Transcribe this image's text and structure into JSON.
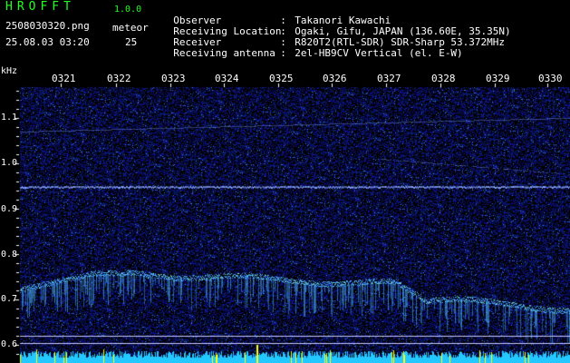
{
  "header": {
    "app_name": "HROFFT",
    "app_version": "1.0.0",
    "file_name": "2508030320.png",
    "date_time": "25.08.03 03:20",
    "meteor_label": "meteor",
    "meteor_count": "25"
  },
  "info": [
    {
      "key": "Observer",
      "sep": ":",
      "value": "Takanori Kawachi"
    },
    {
      "key": "Receiving Location",
      "sep": ":",
      "value": "Ogaki, Gifu, JAPAN (136.60E, 35.35N)"
    },
    {
      "key": "Receiver",
      "sep": ":",
      "value": "R820T2(RTL-SDR) SDR-Sharp 53.372MHz"
    },
    {
      "key": "Receiving antenna",
      "sep": ":",
      "value": "2el-HB9CV Vertical (el. E-W)"
    }
  ],
  "axis": {
    "freq_unit": "kHz",
    "time_ticks": [
      "0321",
      "0322",
      "0323",
      "0324",
      "0325",
      "0326",
      "0327",
      "0328",
      "0329",
      "0330"
    ],
    "freq_ticks": [
      "1.1",
      "1.0",
      "0.9",
      "0.8",
      "0.7",
      "0.6"
    ]
  },
  "colors": {
    "background": "#000000",
    "noise": "#1a2aa8",
    "signal_line": "#8aa8ff",
    "meteor_trace": "#4fb8ff",
    "bottom_band": "#22c8ff",
    "header_title": "#22ff22",
    "tick_marker": "#ffff00"
  }
}
